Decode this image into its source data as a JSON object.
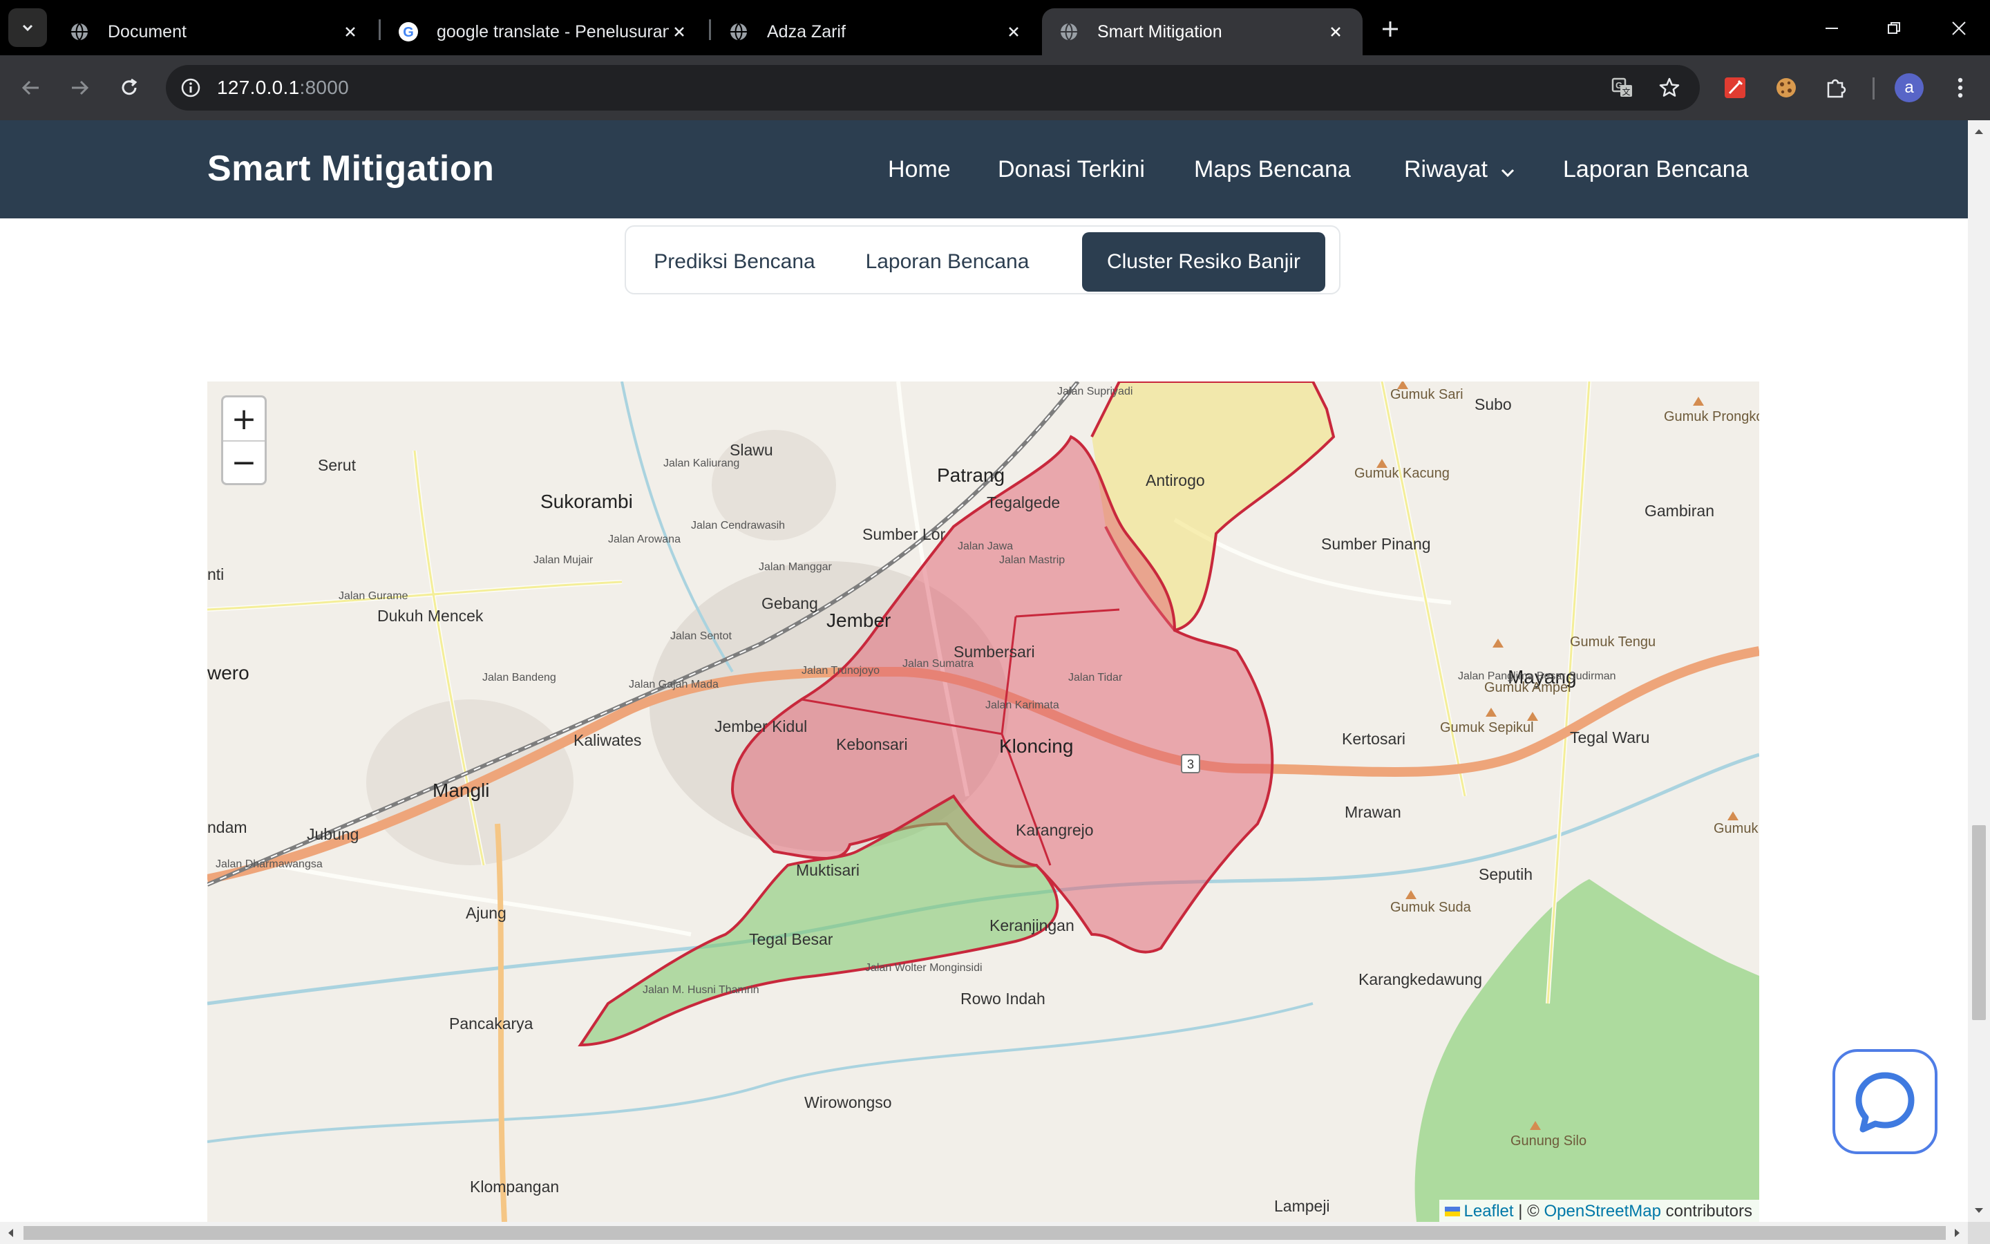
{
  "browser": {
    "tabs": [
      {
        "title": "Document",
        "favicon": "globe-icon"
      },
      {
        "title": "google translate - Penelusuran Google",
        "favicon": "google-icon"
      },
      {
        "title": "Adza Zarif",
        "favicon": "globe-icon"
      },
      {
        "title": "Smart Mitigation",
        "favicon": "globe-icon",
        "active": true
      }
    ],
    "url_host": "127.0.0.1",
    "url_port": ":8000",
    "profile_initial": "a"
  },
  "site": {
    "brand": "Smart Mitigation",
    "nav": [
      "Home",
      "Donasi Terkini",
      "Maps Bencana",
      "Riwayat",
      "Laporan Bencana"
    ],
    "segments": [
      "Prediksi Bencana",
      "Laporan Bencana",
      "Cluster Resiko Banjir"
    ],
    "active_segment": "Cluster Resiko Banjir",
    "header_color": "#2c3e50"
  },
  "map": {
    "zoom_in": "+",
    "zoom_out": "−",
    "attribution": {
      "leaflet": "Leaflet",
      "sep": " | © ",
      "osm": "OpenStreetMap",
      "tail": " contributors"
    },
    "places": [
      "Serut",
      "Slawu",
      "Patrang",
      "Tegalgede",
      "Antirogo",
      "Sukorambi",
      "Sumber Lor",
      "Gebang",
      "Jember",
      "Sumbersari",
      "Dukuh Mencek",
      "Kaliwates",
      "Jember Kidul",
      "Kebonsari",
      "Kloncing",
      "Karangrejo",
      "Mangli",
      "Jubung",
      "Muktisari",
      "Ajung",
      "Tegal Besar",
      "Keranjingan",
      "Rowo Indah",
      "Pancakarya",
      "Wirowongso",
      "Klompangan",
      "Subo",
      "Gumuk Sari",
      "Gumuk Kacung",
      "Sumber Pinang",
      "Gumuk Prongkol",
      "Gambiran",
      "Gumuk Tengu",
      "Mayang",
      "Gumuk Ampel",
      "Gumuk Sepikul",
      "Kertosari",
      "Tegal Waru",
      "Mrawan",
      "Gumuk Ompul",
      "Seputih",
      "Gumuk Suda",
      "Karangkedawung",
      "Gunung Silo",
      "nti",
      "wero",
      "ndam",
      "Lampeji"
    ],
    "roads": [
      "Jalan Trunojoyo",
      "Jalan Gajah Mada",
      "Jalan Karimata",
      "Jalan Tidar",
      "Jalan Sumatra",
      "Jalan Jawa",
      "Jalan M. Husni Thamrin",
      "Jalan Wolter Monginsidi",
      "Jalan Panglima Besar Sudirman",
      "Jalan Gurame",
      "Jalan Bandeng",
      "Jalan Mujair",
      "Jalan Arowana",
      "Jalan Kaliurang",
      "Jalan Dharmawangsa",
      "Jalan Supriyadi",
      "Jalan Cendrawasih",
      "Jalan Manggar",
      "Jalan Sentot",
      "Jalan Mastrip"
    ],
    "route_shield": "3",
    "cluster_colors": {
      "high": "#e06070",
      "medium": "#f2e27a",
      "low": "#7cc66a",
      "border": "#c8283c"
    }
  }
}
